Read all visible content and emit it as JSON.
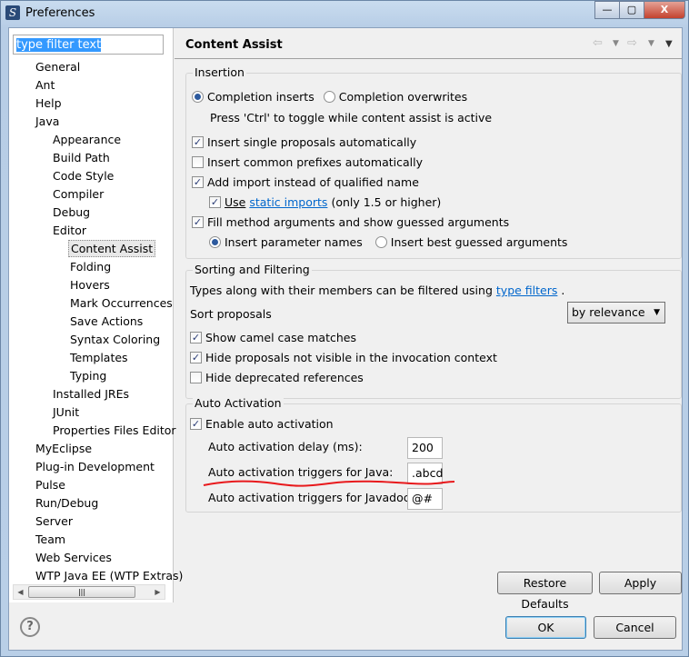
{
  "window": {
    "title": "Preferences"
  },
  "filter": {
    "placeholder": "type filter text"
  },
  "tree": [
    {
      "label": "General",
      "level": 0
    },
    {
      "label": "Ant",
      "level": 0
    },
    {
      "label": "Help",
      "level": 0
    },
    {
      "label": "Java",
      "level": 0
    },
    {
      "label": "Appearance",
      "level": 1
    },
    {
      "label": "Build Path",
      "level": 1
    },
    {
      "label": "Code Style",
      "level": 1
    },
    {
      "label": "Compiler",
      "level": 1
    },
    {
      "label": "Debug",
      "level": 1
    },
    {
      "label": "Editor",
      "level": 1
    },
    {
      "label": "Content Assist",
      "level": 2,
      "selected": true
    },
    {
      "label": "Folding",
      "level": 2
    },
    {
      "label": "Hovers",
      "level": 2
    },
    {
      "label": "Mark Occurrences",
      "level": 2
    },
    {
      "label": "Save Actions",
      "level": 2
    },
    {
      "label": "Syntax Coloring",
      "level": 2
    },
    {
      "label": "Templates",
      "level": 2
    },
    {
      "label": "Typing",
      "level": 2
    },
    {
      "label": "Installed JREs",
      "level": 1
    },
    {
      "label": "JUnit",
      "level": 1
    },
    {
      "label": "Properties Files Editor",
      "level": 1
    },
    {
      "label": "MyEclipse",
      "level": 0
    },
    {
      "label": "Plug-in Development",
      "level": 0
    },
    {
      "label": "Pulse",
      "level": 0
    },
    {
      "label": "Run/Debug",
      "level": 0
    },
    {
      "label": "Server",
      "level": 0
    },
    {
      "label": "Team",
      "level": 0
    },
    {
      "label": "Web Services",
      "level": 0
    },
    {
      "label": "WTP Java EE (WTP Extras)",
      "level": 0
    }
  ],
  "page": {
    "title": "Content Assist"
  },
  "insertion": {
    "legend": "Insertion",
    "completion_inserts": "Completion inserts",
    "completion_overwrites": "Completion overwrites",
    "toggle_hint": "Press 'Ctrl' to toggle while content assist is active",
    "single_proposals": "Insert single proposals automatically",
    "common_prefixes": "Insert common prefixes automatically",
    "add_import": "Add import instead of qualified name",
    "use": "Use",
    "static_imports": "static imports",
    "only15": "(only 1.5 or higher)",
    "fill_method": "Fill method arguments and show guessed arguments",
    "param_names": "Insert parameter names",
    "best_guessed": "Insert best guessed arguments"
  },
  "sorting": {
    "legend": "Sorting and Filtering",
    "types_text": "Types along with their members can be filtered using",
    "type_filters": "type filters",
    "sort_label": "Sort proposals",
    "sort_value": "by relevance",
    "camel": "Show camel case matches",
    "hide_not_visible": "Hide proposals not visible in the invocation context",
    "hide_deprecated": "Hide deprecated references"
  },
  "auto": {
    "legend": "Auto Activation",
    "enable": "Enable auto activation",
    "delay_label": "Auto activation delay (ms):",
    "delay_value": "200",
    "java_label": "Auto activation triggers for Java:",
    "java_value": ".abcd",
    "javadoc_label": "Auto activation triggers for Javadoc:",
    "javadoc_value": "@#"
  },
  "buttons": {
    "restore": "Restore Defaults",
    "apply": "Apply",
    "ok": "OK",
    "cancel": "Cancel",
    "help": "?"
  }
}
